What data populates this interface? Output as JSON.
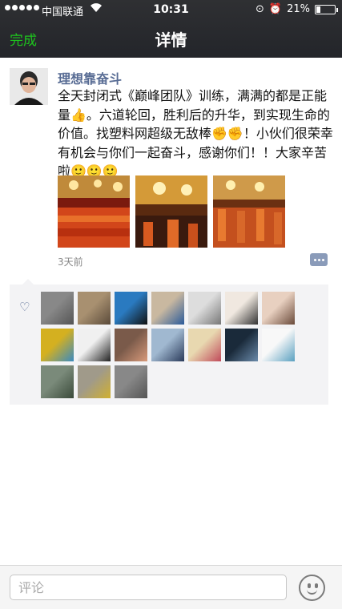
{
  "status_bar": {
    "carrier": "中国联通",
    "time": "10:31",
    "battery": "21%",
    "battery_level": 0.21
  },
  "nav": {
    "done_label": "完成",
    "title": "详情"
  },
  "post": {
    "username": "理想靠奋斗",
    "text": "全天封闭式《巅峰团队》训练，满满的都是正能量👍。六道轮回，胜利后的升华，到实现生命的价值。找塑料网超级无敌棒✊✊！小伙们很荣幸有机会与你们一起奋斗，感谢你们！！大家辛苦啦🙂🙂🙂",
    "time": "3天前",
    "photo_count": 3
  },
  "likes": {
    "count": 17
  },
  "comment_bar": {
    "placeholder": "评论"
  },
  "colors": {
    "accent_green": "#1ec41e",
    "name_blue": "#586c94"
  }
}
